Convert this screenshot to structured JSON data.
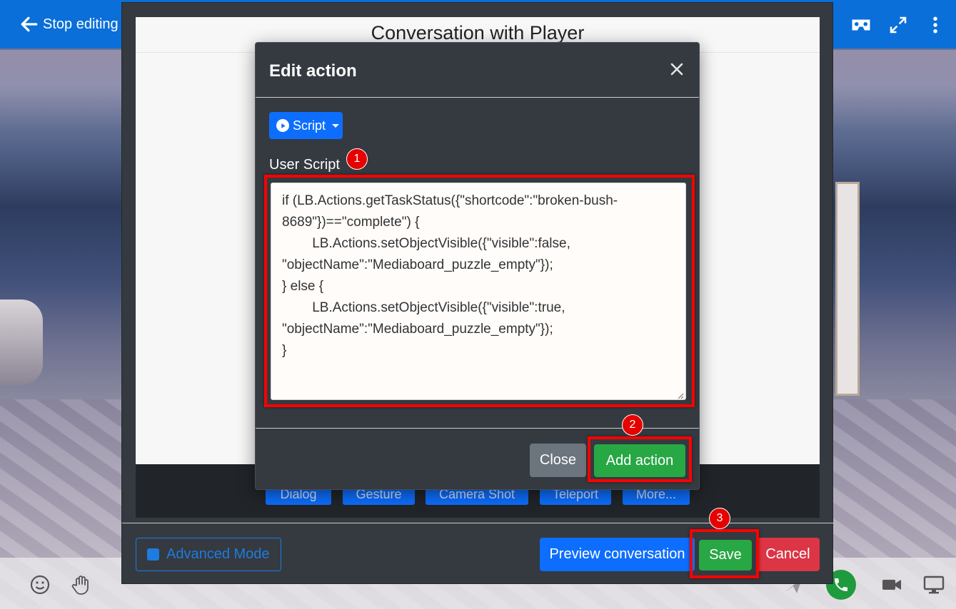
{
  "topbar": {
    "back_label": "Stop editing"
  },
  "outer_dialog": {
    "title": "Conversation with Player",
    "actions": [
      "Dialog",
      "Gesture",
      "Camera Shot",
      "Teleport",
      "More..."
    ],
    "advanced_mode_label": "Advanced Mode",
    "preview_label": "Preview conversation",
    "save_label": "Save",
    "cancel_label": "Cancel"
  },
  "modal": {
    "title": "Edit action",
    "type_button_label": "Script",
    "field_label": "User Script",
    "script_value": "if (LB.Actions.getTaskStatus({\"shortcode\":\"broken-bush-8689\"})==\"complete\") {\n        LB.Actions.setObjectVisible({\"visible\":false,\n\"objectName\":\"Mediaboard_puzzle_empty\"});\n} else {\n        LB.Actions.setObjectVisible({\"visible\":true,\n\"objectName\":\"Mediaboard_puzzle_empty\"});\n}",
    "close_label": "Close",
    "add_label": "Add action"
  },
  "annotations": [
    "1",
    "2",
    "3"
  ],
  "colors": {
    "primary": "#0d6efd",
    "success": "#28a745",
    "danger": "#dc3545",
    "secondary": "#6c757d",
    "highlight": "#ff0000",
    "modal_bg": "#343a40"
  }
}
